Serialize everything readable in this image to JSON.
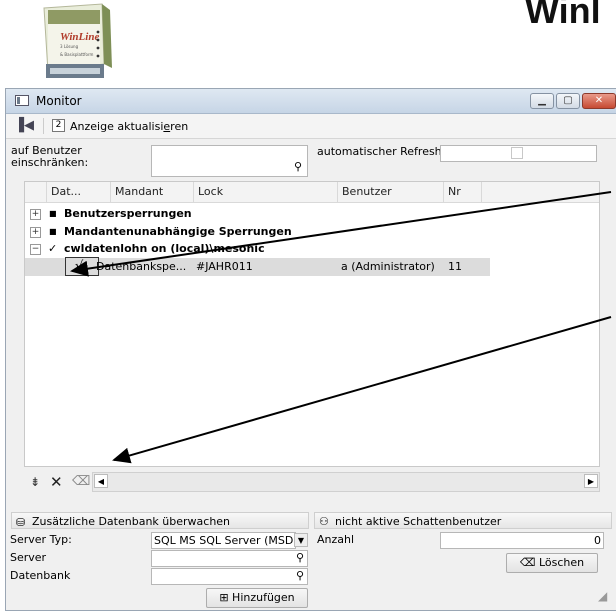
{
  "doc_title": "Winl",
  "box_art": {
    "line1": "WinLine",
    "line2": "3 Lösung",
    "line3": "& Basisplattform"
  },
  "window": {
    "title": "Monitor",
    "icon": "monitor-icon",
    "controls": [
      "minimize",
      "maximize",
      "close"
    ]
  },
  "toolbar": {
    "refresh_label_pre": "Anzeige aktualisi",
    "refresh_label_u": "e",
    "refresh_label_post": "ren"
  },
  "filter": {
    "user_label_line1": "auf Benutzer",
    "user_label_line2": "einschränken:",
    "user_value": "",
    "auto_refresh_label": "automatischer Refresh",
    "auto_refresh_checked": false
  },
  "grid": {
    "columns": [
      "Dat...",
      "Mandant",
      "Lock",
      "Benutzer",
      "Nr"
    ],
    "groups": [
      {
        "label": "Benutzersperrungen",
        "expanded": false,
        "marker": "■"
      },
      {
        "label": "Mandantenunabhängige Sperrungen",
        "expanded": false,
        "marker": "■"
      },
      {
        "label": "cwldatenlohn on (local)\\mesonic",
        "expanded": true,
        "marker": "✓"
      }
    ],
    "rows": [
      {
        "check": "√",
        "mandant": "Datenbankspe...",
        "lock": "#JAHR011",
        "benutzer": "a (Administrator)",
        "nr": "11"
      }
    ]
  },
  "bottom_toolbar": {
    "icons": [
      "collapse-icon",
      "delete-icon",
      "eraser-icon"
    ]
  },
  "db_panel": {
    "title": "Zusätzliche Datenbank überwachen",
    "server_type_label": "Server Typ:",
    "server_type_value": "SQL MS SQL Server (MSDE)",
    "server_label": "Server",
    "server_value": "",
    "database_label": "Datenbank",
    "database_value": "",
    "add_button": "Hinzufügen"
  },
  "shadow_panel": {
    "title": "nicht aktive Schattenbenutzer",
    "count_label": "Anzahl",
    "count_value": "0",
    "delete_button": "Löschen"
  }
}
